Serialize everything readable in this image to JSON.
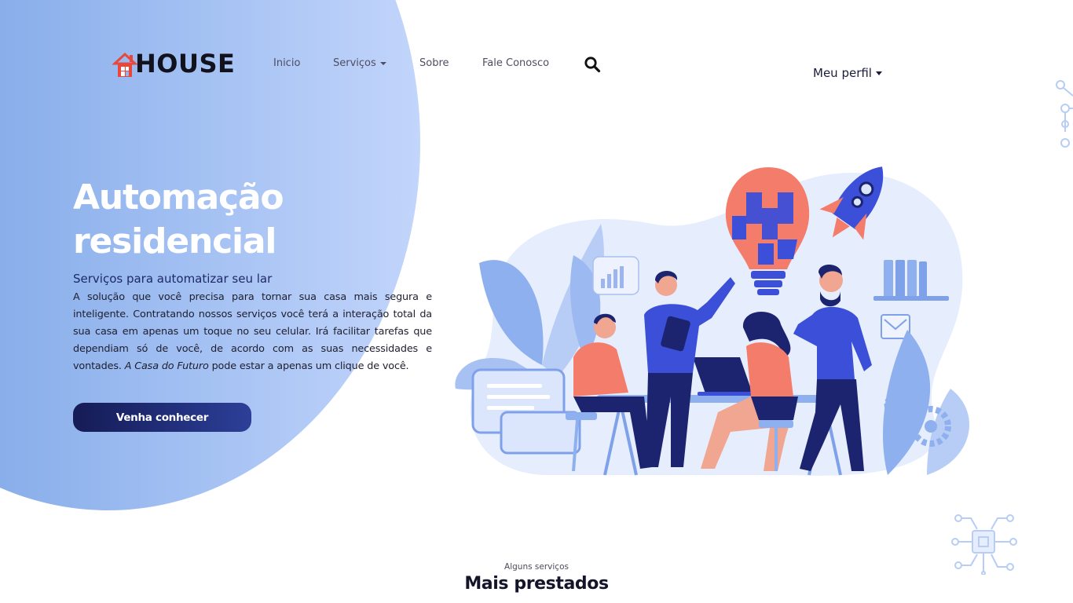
{
  "brand": {
    "name": "HOUSE"
  },
  "nav": {
    "items": [
      {
        "label": "Inicio"
      },
      {
        "label": "Serviços"
      },
      {
        "label": "Sobre"
      },
      {
        "label": "Fale Conosco"
      }
    ],
    "profile_label": "Meu perfil"
  },
  "hero": {
    "title_line1": "Automação",
    "title_line2": "residencial",
    "subtitle": "Serviços para automatizar seu lar",
    "body": "A solução que você precisa para tornar sua casa mais segura e inteligente. Contratando nossos serviços você terá a interação total da sua casa em apenas um toque no seu celular. Irá facilitar tarefas que dependiam só de você, de acordo com as suas necessidades e vontades.",
    "body_italic": "A Casa do Futuro",
    "body_tail": "pode estar a apenas um clique de você.",
    "cta_label": "Venha conhecer"
  },
  "services": {
    "kicker": "Alguns serviços",
    "title": "Mais prestados"
  },
  "icons": {
    "logo": "house-logo-icon",
    "search": "search-icon",
    "dropdown": "chevron-down-icon",
    "illustration": "team-teamwork-illustration",
    "circuit": "circuit-board-icon"
  },
  "colors": {
    "accent_blob_start": "#6d9be0",
    "accent_blob_end": "#c2d5fb",
    "cta_start": "#151b55",
    "cta_end": "#2c3f98",
    "illustration_blue": "#3b4fd8",
    "illustration_coral": "#f47c6b"
  }
}
